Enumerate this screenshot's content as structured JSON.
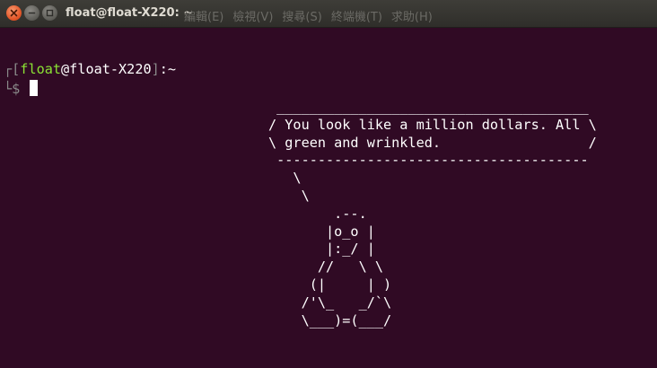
{
  "window": {
    "title": "float@float-X220: ~",
    "menu": [
      "編輯(E)",
      "檢視(V)",
      "搜尋(S)",
      "終端機(T)",
      "求助(H)"
    ]
  },
  "terminal": {
    "prompt": {
      "open_bracket": "┌[",
      "user": "float",
      "at": "@",
      "host": "float-X220",
      "close_bracket": "]",
      "path": ":~",
      "second_line_prefix": "└$ "
    },
    "output_lines": [
      " ______________________________________",
      "/ You look like a million dollars. All \\",
      "\\ green and wrinkled.                  /",
      " --------------------------------------",
      "   \\",
      "    \\",
      "        .--.",
      "       |o_o |",
      "       |:_/ |",
      "      //   \\ \\",
      "     (|     | )",
      "    /'\\_   _/`\\",
      "    \\___)=(___/"
    ]
  },
  "colors": {
    "background": "#300a24",
    "user": "#8ae234",
    "text": "#ffffff"
  }
}
